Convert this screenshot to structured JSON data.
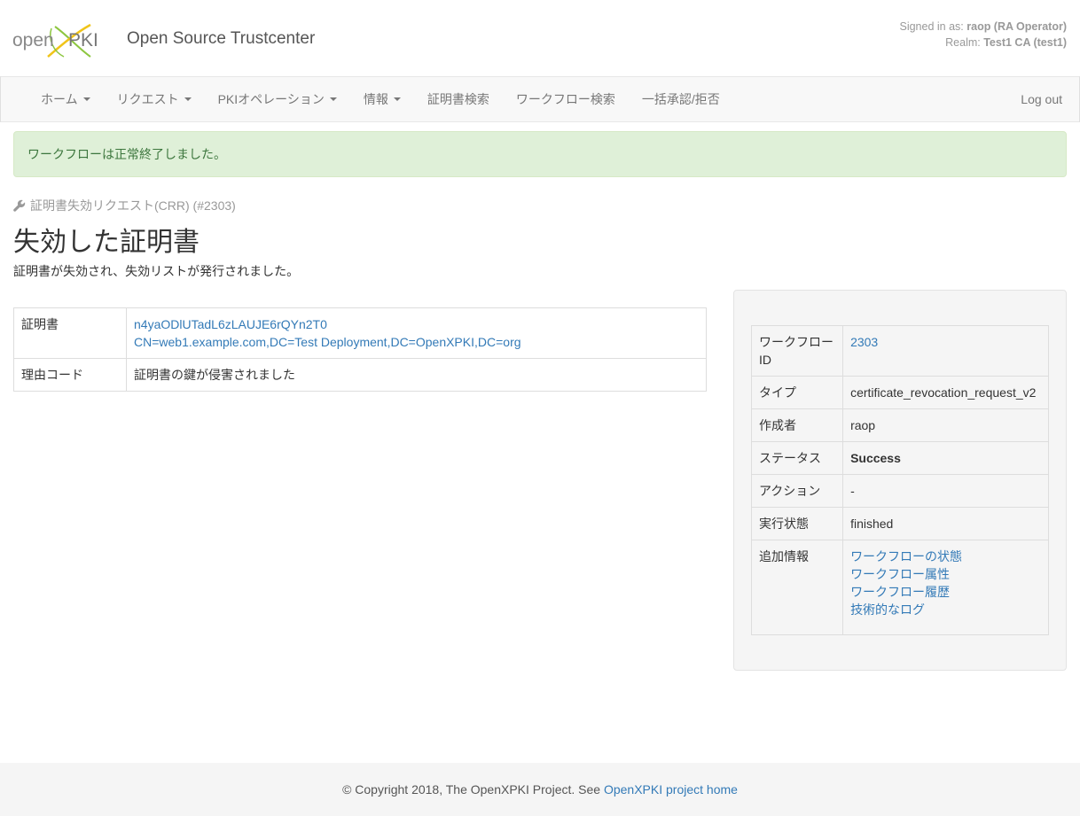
{
  "header": {
    "site_title": "Open Source Trustcenter",
    "signed_in_prefix": "Signed in as:",
    "user": "raop (RA Operator)",
    "realm_prefix": "Realm:",
    "realm": "Test1 CA (test1)"
  },
  "nav": {
    "items": [
      {
        "label": "ホーム",
        "dropdown": true
      },
      {
        "label": "リクエスト",
        "dropdown": true
      },
      {
        "label": "PKIオペレーション",
        "dropdown": true
      },
      {
        "label": "情報",
        "dropdown": true
      },
      {
        "label": "証明書検索",
        "dropdown": false
      },
      {
        "label": "ワークフロー検索",
        "dropdown": false
      },
      {
        "label": "一括承認/拒否",
        "dropdown": false
      }
    ],
    "logout": "Log out"
  },
  "alert": {
    "message": "ワークフローは正常終了しました。"
  },
  "page": {
    "breadcrumb": "証明書失効リクエスト(CRR) (#2303)",
    "title": "失効した証明書",
    "description": "証明書が失効され、失効リストが発行されました。"
  },
  "details": {
    "certificate_label": "証明書",
    "certificate_id": "n4yaODlUTadL6zLAUJE6rQYn2T0",
    "certificate_subject": "CN=web1.example.com,DC=Test Deployment,DC=OpenXPKI,DC=org",
    "reason_label": "理由コード",
    "reason_value": "証明書の鍵が侵害されました"
  },
  "workflow_info": {
    "id_label": "ワークフローID",
    "id_value": "2303",
    "type_label": "タイプ",
    "type_value": "certificate_revocation_request_v2",
    "creator_label": "作成者",
    "creator_value": "raop",
    "status_label": "ステータス",
    "status_value": "Success",
    "action_label": "アクション",
    "action_value": "-",
    "state_label": "実行状態",
    "state_value": "finished",
    "extra_label": "追加情報",
    "extra_links": [
      "ワークフローの状態",
      "ワークフロー属性",
      "ワークフロー履歴",
      "技術的なログ"
    ]
  },
  "footer": {
    "copyright": "© Copyright 2018, The OpenXPKI Project. See",
    "link": "OpenXPKI project home"
  },
  "colors": {
    "link": "#337ab7",
    "alert_bg": "#dff0d8",
    "alert_text": "#3c763d",
    "logo_green": "#8dc63f",
    "logo_yellow": "#f0c419"
  }
}
